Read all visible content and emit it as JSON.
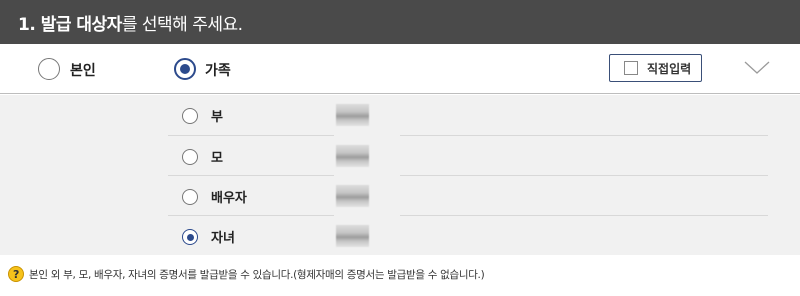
{
  "header": {
    "title_bold": "1. 발급 대상자",
    "title_normal": "를 선택해 주세요."
  },
  "target_options": [
    {
      "label": "본인",
      "checked": false
    },
    {
      "label": "가족",
      "checked": true
    }
  ],
  "direct_input_label": "직접입력",
  "family_members": [
    {
      "label": "부",
      "checked": false
    },
    {
      "label": "모",
      "checked": false
    },
    {
      "label": "배우자",
      "checked": false
    },
    {
      "label": "자녀",
      "checked": true
    }
  ],
  "note": {
    "icon": "?",
    "text": "본인 외 부, 모, 배우자, 자녀의 증명서를 발급받을 수 있습니다.(형제자매의 증명서는 발급받을 수 없습니다.)"
  },
  "colors": {
    "header_bg": "#4a4a4a",
    "accent": "#2c4a8c",
    "list_bg": "#f1f1f1",
    "help_icon": "#f6c21b"
  }
}
